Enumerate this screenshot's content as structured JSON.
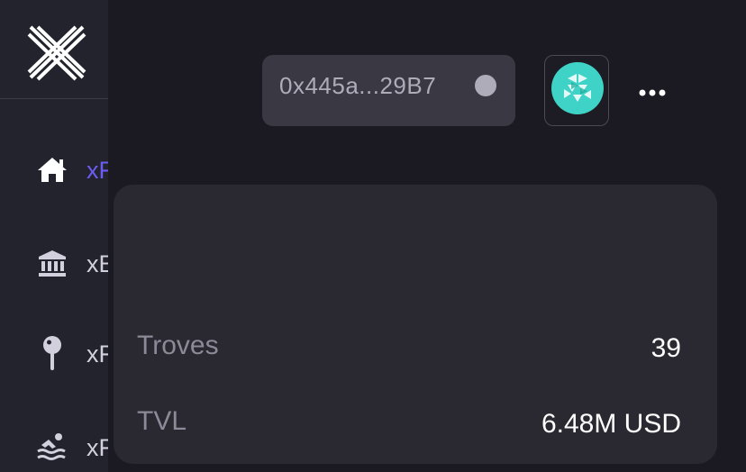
{
  "nav": {
    "items": [
      {
        "label": "xF",
        "icon": "home-icon",
        "active": true
      },
      {
        "label": "xE",
        "icon": "bank-icon",
        "active": false
      },
      {
        "label": "xF",
        "icon": "pin-icon",
        "active": false
      },
      {
        "label": "xF",
        "icon": "pool-icon",
        "active": false
      }
    ]
  },
  "wallet": {
    "address": "0x445a...29B7"
  },
  "stats": {
    "troves_label": "Troves",
    "troves_value": "39",
    "tvl_label": "TVL",
    "tvl_value": "6.48M USD"
  },
  "colors": {
    "accent": "#6b5cf2",
    "avatar": "#3ed3c6",
    "card": "#2a2932",
    "sidebar": "#23232d"
  }
}
